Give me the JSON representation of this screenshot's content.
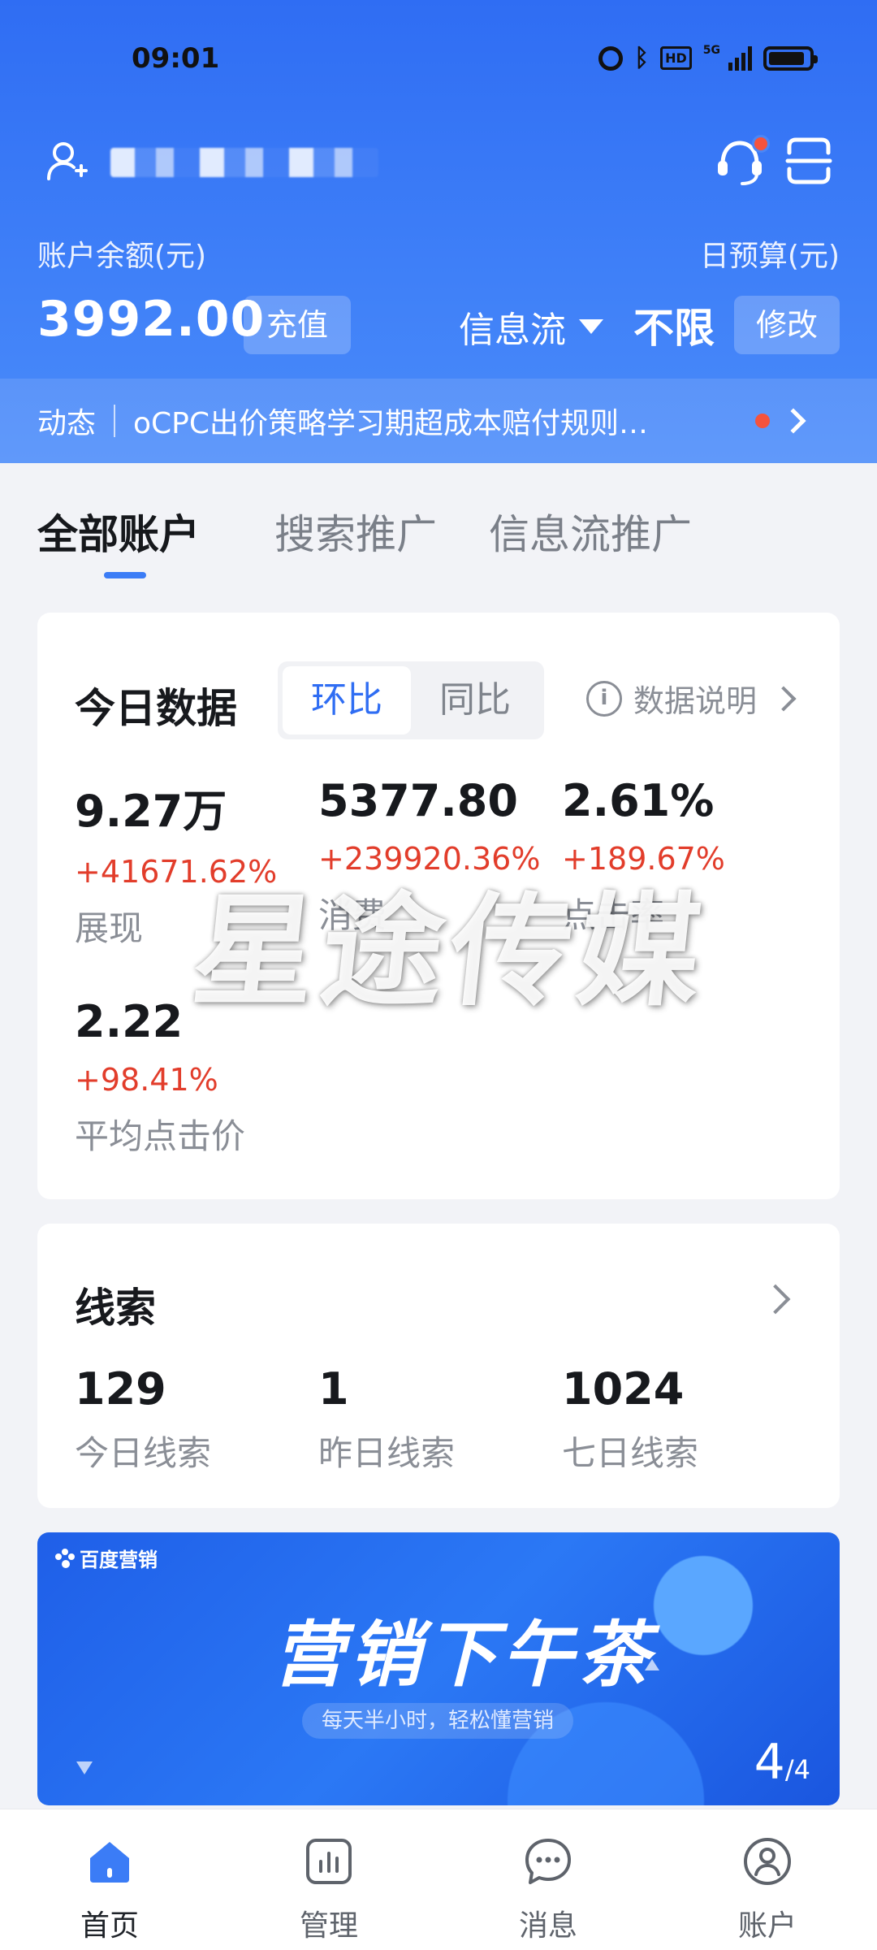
{
  "status_bar": {
    "time": "09:01",
    "network": "5G",
    "hd": "HD",
    "battery_level": 0.9
  },
  "account": {
    "name_masked": ""
  },
  "balance": {
    "label": "账户余额(元)",
    "value": "3992.00",
    "recharge_button": "充值"
  },
  "budget": {
    "label": "日预算(元)",
    "type_select": "信息流",
    "value": "不限",
    "modify_button": "修改"
  },
  "news": {
    "label": "动态",
    "text": "oCPC出价策略学习期超成本赔付规则…"
  },
  "tabs": [
    {
      "label": "全部账户",
      "active": true
    },
    {
      "label": "搜索推广",
      "active": false
    },
    {
      "label": "信息流推广",
      "active": false
    }
  ],
  "today": {
    "title": "今日数据",
    "compare_options": [
      "环比",
      "同比"
    ],
    "compare_selected": "环比",
    "explain_label": "数据说明",
    "metrics": [
      {
        "value": "9.27万",
        "change": "+41671.62%",
        "label": "展现"
      },
      {
        "value": "5377.80",
        "change": "+239920.36%",
        "label": "消费"
      },
      {
        "value": "2.61%",
        "change": "+189.67%",
        "label": "点击率"
      },
      {
        "value": "2.22",
        "change": "+98.41%",
        "label": "平均点击价"
      }
    ]
  },
  "watermark": "星途传媒",
  "leads": {
    "title": "线索",
    "items": [
      {
        "value": "129",
        "label": "今日线索"
      },
      {
        "value": "1",
        "label": "昨日线索"
      },
      {
        "value": "1024",
        "label": "七日线索"
      }
    ]
  },
  "banner": {
    "logo": "百度营销",
    "title": "营销下午茶",
    "subtitle": "每天半小时，轻松懂营销",
    "page_current": "4",
    "page_total": "/4"
  },
  "bottom_nav": [
    {
      "label": "首页",
      "icon": "home-icon",
      "active": true
    },
    {
      "label": "管理",
      "icon": "chart-icon",
      "active": false
    },
    {
      "label": "消息",
      "icon": "message-icon",
      "active": false
    },
    {
      "label": "账户",
      "icon": "user-icon",
      "active": false
    }
  ],
  "colors": {
    "primary": "#2f6df3",
    "increase": "#e23d2b",
    "badge": "#f5533d"
  }
}
